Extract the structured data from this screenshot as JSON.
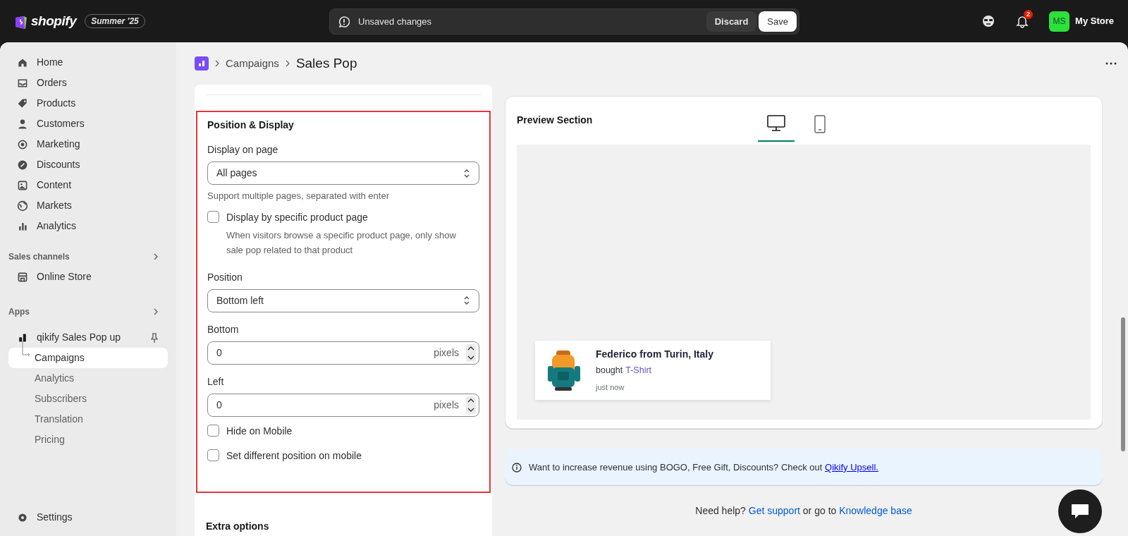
{
  "topbar": {
    "brand": "shopify",
    "edition": "Summer '25",
    "unsaved": "Unsaved changes",
    "buttons": [
      {
        "label": "Discard",
        "kind": "secondary"
      },
      {
        "label": "Save",
        "kind": "primary"
      }
    ],
    "notification_count": "2",
    "avatar": "MS",
    "store": "My Store"
  },
  "sidebar": {
    "items": [
      {
        "label": "Home",
        "selected": false
      },
      {
        "label": "Orders",
        "selected": false
      },
      {
        "label": "Products",
        "selected": false
      },
      {
        "label": "Customers",
        "selected": false
      },
      {
        "label": "Marketing",
        "selected": false
      },
      {
        "label": "Discounts",
        "selected": false
      },
      {
        "label": "Content",
        "selected": false
      },
      {
        "label": "Markets",
        "selected": false
      },
      {
        "label": "Analytics",
        "selected": false
      }
    ],
    "sales_channels": {
      "title": "Sales channels",
      "items": [
        {
          "label": "Online Store",
          "selected": false
        }
      ]
    },
    "apps": {
      "title": "Apps",
      "app": {
        "label": "qikify Sales Pop up",
        "children": [
          {
            "label": "Campaigns",
            "selected": true
          },
          {
            "label": "Analytics",
            "selected": false
          },
          {
            "label": "Subscribers",
            "selected": false
          },
          {
            "label": "Translation",
            "selected": false
          },
          {
            "label": "Pricing",
            "selected": false
          }
        ]
      }
    },
    "settings": "Settings"
  },
  "breadcrumb": {
    "parent": "Campaigns",
    "current": "Sales Pop"
  },
  "form": {
    "title": "Position & Display",
    "fields": [
      {
        "kind": "select",
        "label": "Display on page",
        "value": "All pages",
        "help": "Support multiple pages, separated with enter"
      },
      {
        "kind": "checkbox",
        "label": "Display by specific product page",
        "checked": false,
        "help": "When visitors browse a specific product page, only show sale pop related to that product"
      },
      {
        "kind": "select",
        "label": "Position",
        "value": "Bottom left"
      },
      {
        "kind": "number",
        "label": "Bottom",
        "value": "0",
        "unit": "pixels"
      },
      {
        "kind": "number",
        "label": "Left",
        "value": "0",
        "unit": "pixels"
      },
      {
        "kind": "checkbox",
        "label": "Hide on Mobile",
        "checked": false
      },
      {
        "kind": "checkbox",
        "label": "Set different position on mobile",
        "checked": false
      }
    ],
    "next_section": "Extra options"
  },
  "preview": {
    "title": "Preview Section",
    "devices": [
      {
        "kind": "desktop",
        "selected": true
      },
      {
        "kind": "mobile",
        "selected": false
      }
    ],
    "popup": {
      "name": "Federico from Turin, Italy",
      "action": "bought",
      "product": "T-Shirt",
      "time": "just now"
    }
  },
  "banner": {
    "text": "Want to increase revenue using BOGO, Free Gift, Discounts? Check out",
    "link": "Qikify Upsell."
  },
  "help": {
    "prefix": "Need help?",
    "support_link": "Get support",
    "middle": "or go to",
    "kb_link": "Knowledge base"
  }
}
